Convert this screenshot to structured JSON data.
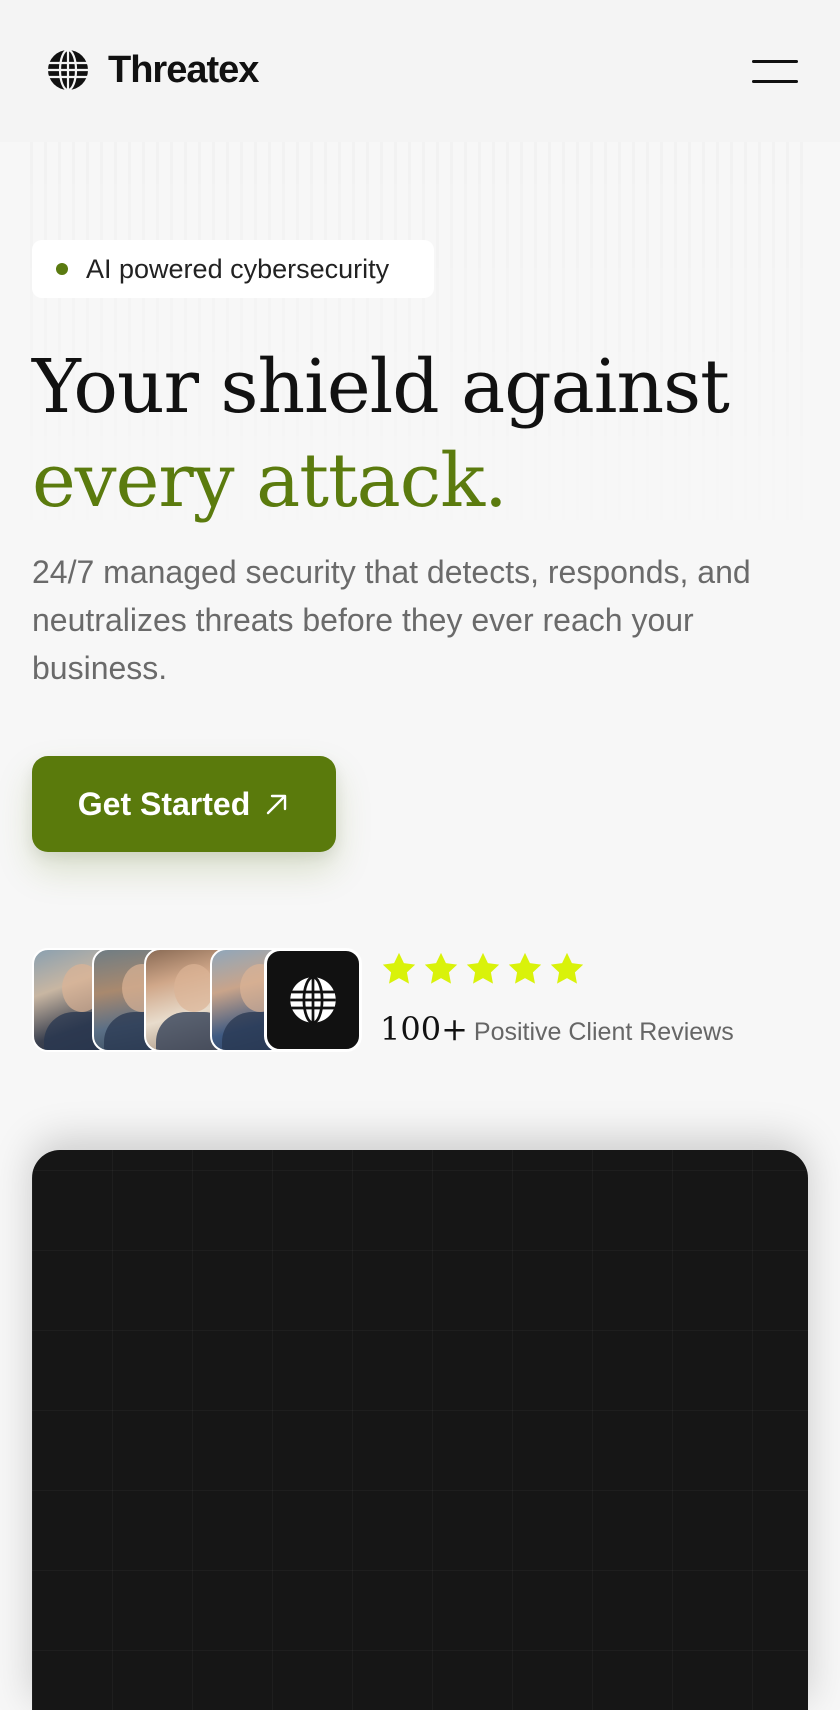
{
  "header": {
    "brand": "Threatex",
    "logo_icon": "globe-icon",
    "menu_icon": "hamburger-menu-icon"
  },
  "hero": {
    "badge": "AI powered cybersecurity",
    "headline_line1": "Your shield against",
    "headline_line2": "every attack.",
    "subtext": "24/7 managed security that detects, responds, and neutralizes threats before they ever reach your business.",
    "cta_label": "Get Started",
    "cta_icon": "arrow-up-right-icon"
  },
  "social_proof": {
    "rating_stars": 5,
    "reviews_count": "100+",
    "reviews_label": "Positive Client Reviews"
  },
  "colors": {
    "accent_green": "#5a7a0c",
    "star_yellow": "#d9f20a",
    "dark_panel": "#161616",
    "background": "#f7f7f7"
  }
}
